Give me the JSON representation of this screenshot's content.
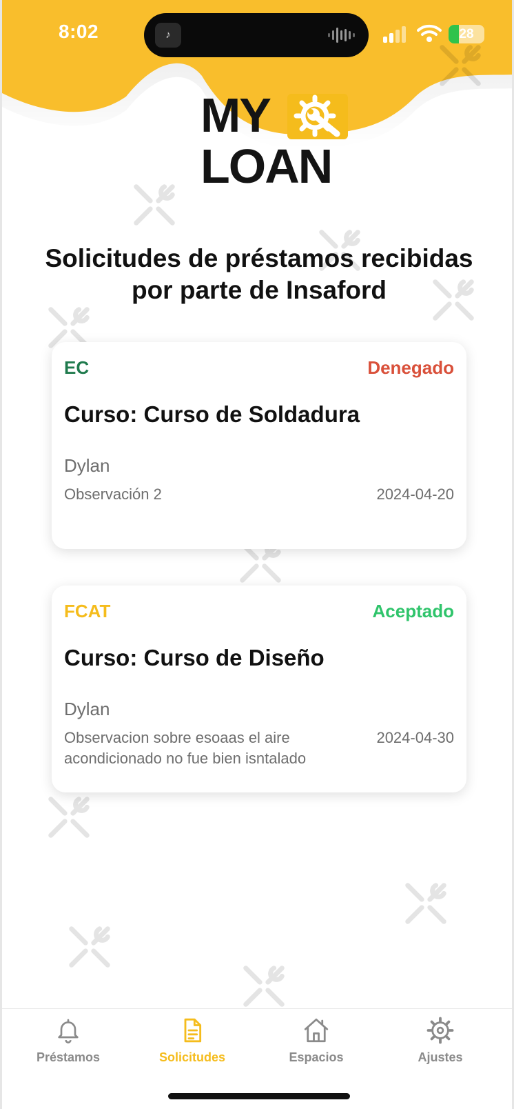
{
  "status_bar": {
    "time": "8:02",
    "battery": "28",
    "battery_level": 0.28,
    "island_app_glyph": "♪"
  },
  "logo": {
    "line1": "MY",
    "line2": "LOAN"
  },
  "page": {
    "title": "Solicitudes de préstamos recibidas por parte de Insaford"
  },
  "colors": {
    "accent": "#f5bc1c",
    "denied": "#d9503a",
    "accepted": "#2fc46b",
    "code_green": "#1f7a4d",
    "code_yellow": "#f5bc1c"
  },
  "requests": [
    {
      "code": "EC",
      "status": "Denegado",
      "course": "Curso: Curso de Soldadura",
      "name": "Dylan",
      "observation": "Observación 2",
      "date": "2024-04-20"
    },
    {
      "code": "FCAT",
      "status": "Aceptado",
      "course": "Curso: Curso de Diseño",
      "name": "Dylan",
      "observation": "Observacion sobre esoaas el aire acondicionado no fue bien isntalado",
      "date": "2024-04-30"
    }
  ],
  "tabs": [
    {
      "label": "Préstamos",
      "icon": "bell-icon",
      "active": false
    },
    {
      "label": "Solicitudes",
      "icon": "document-icon",
      "active": true
    },
    {
      "label": "Espacios",
      "icon": "house-icon",
      "active": false
    },
    {
      "label": "Ajustes",
      "icon": "gear-icon",
      "active": false
    }
  ]
}
